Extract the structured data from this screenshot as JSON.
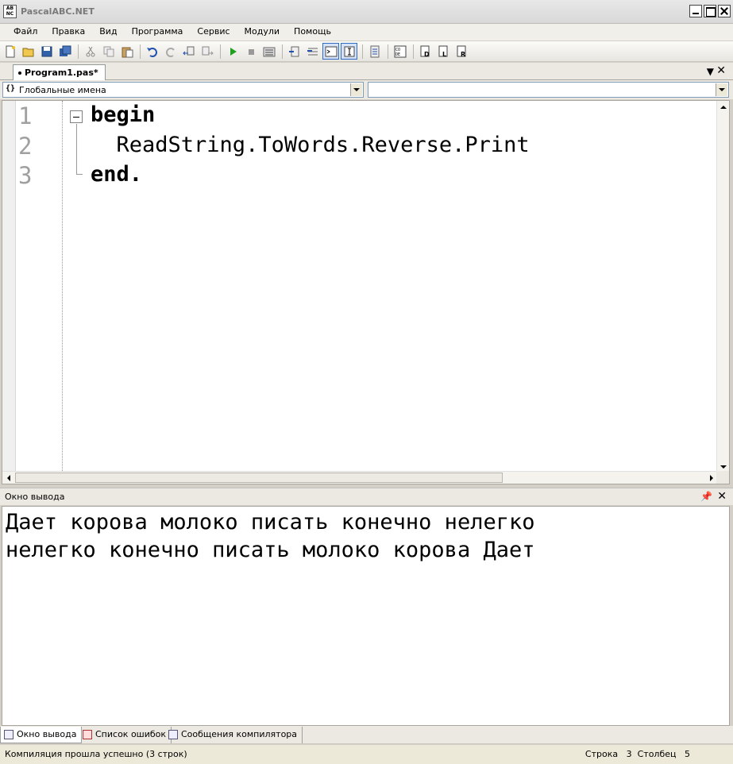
{
  "window": {
    "title": "PascalABC.NET",
    "icon_text": "AB NC"
  },
  "menu": [
    "Файл",
    "Правка",
    "Вид",
    "Программа",
    "Сервис",
    "Модули",
    "Помощь"
  ],
  "toolbar": {
    "icons": [
      "new-file-icon",
      "open-icon",
      "save-icon",
      "save-all-icon",
      "cut-icon",
      "copy-icon",
      "paste-icon",
      "undo-icon",
      "redo-icon",
      "navigate-back-icon",
      "navigate-forward-icon",
      "run-icon",
      "stop-icon",
      "compile-icon",
      "step-into-icon",
      "step-over-icon",
      "output-window-icon",
      "debug-window-icon",
      "format-icon",
      "code-template-icon",
      "insert-def-icon",
      "insert-desc-icon",
      "insert-unit-icon"
    ]
  },
  "tabs": {
    "active": "Program1.pas*"
  },
  "combos": {
    "scope": "Глобальные имена",
    "scope_icon": "{}",
    "member": ""
  },
  "editor": {
    "lines": [
      {
        "num": "1",
        "code": "begin"
      },
      {
        "num": "2",
        "code": "  ReadString.ToWords.Reverse.Print"
      },
      {
        "num": "3",
        "code": "end."
      }
    ]
  },
  "output": {
    "title": "Окно вывода",
    "lines": [
      "Дает корова молоко писать конечно нелегко",
      "нелегко конечно писать молоко корова Дает"
    ]
  },
  "bottom_tabs": [
    "Окно вывода",
    "Список ошибок",
    "Сообщения компилятора"
  ],
  "status": {
    "message": "Компиляция прошла успешно (3 строк)",
    "row_label": "Строка",
    "row": "3",
    "col_label": "Столбец",
    "col": "5"
  }
}
